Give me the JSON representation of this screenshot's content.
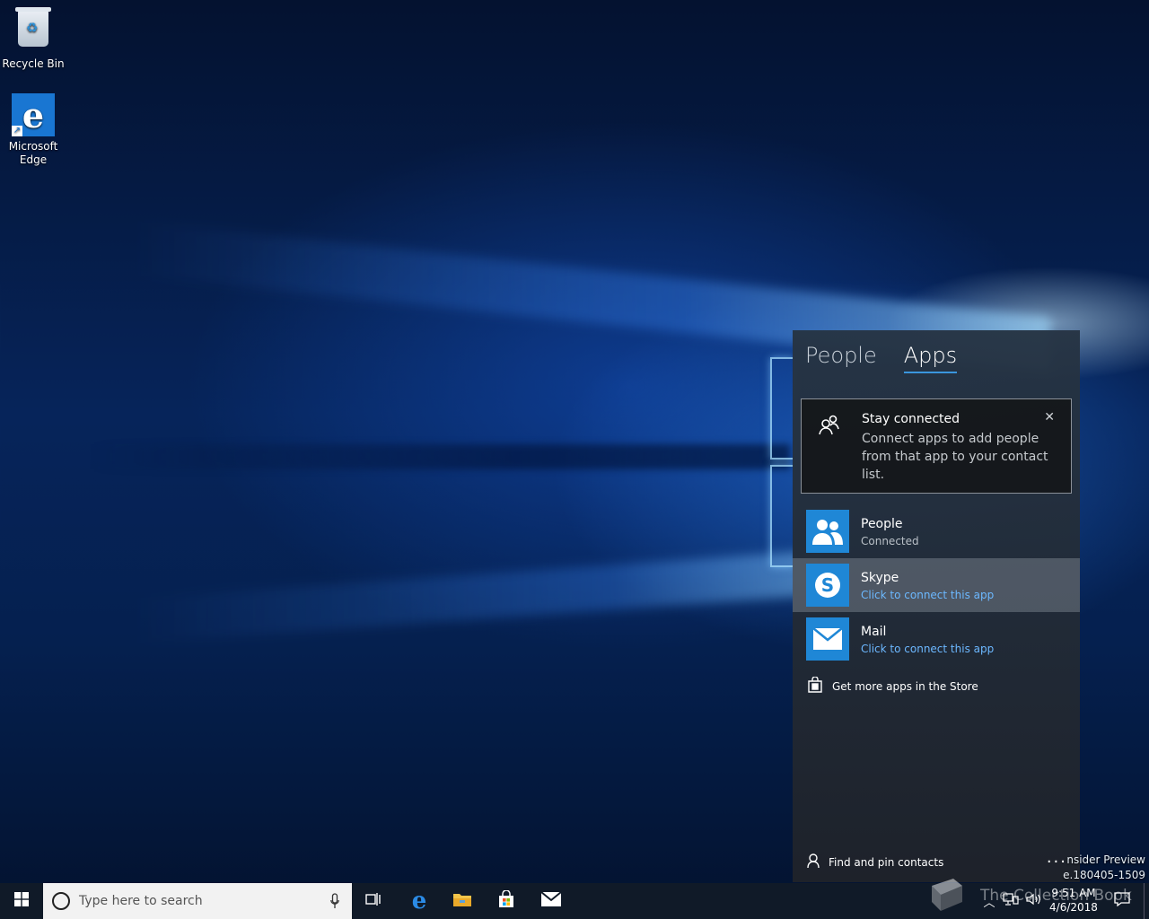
{
  "desktop": {
    "icons": [
      {
        "label": "Recycle Bin"
      },
      {
        "label": "Microsoft Edge"
      }
    ],
    "build_lines": [
      "nsider Preview",
      "e.180405-1509"
    ],
    "watermark": "The Collection Book"
  },
  "flyout": {
    "tabs": [
      {
        "label": "People",
        "active": false
      },
      {
        "label": "Apps",
        "active": true
      }
    ],
    "banner": {
      "title": "Stay connected",
      "body": "Connect apps to add people from that app to your contact list.",
      "close_icon": "close-icon"
    },
    "apps": [
      {
        "name": "People",
        "status": "Connected",
        "icon": "people-icon"
      },
      {
        "name": "Skype",
        "status": "Click to connect this app",
        "icon": "skype-icon"
      },
      {
        "name": "Mail",
        "status": "Click to connect this app",
        "icon": "mail-icon"
      }
    ],
    "store_link": "Get more apps in the Store",
    "find_contacts": "Find and pin contacts",
    "more": "..."
  },
  "taskbar": {
    "search_placeholder": "Type here to search",
    "pinned": [
      "task-view-icon",
      "edge-icon",
      "file-explorer-icon",
      "store-icon",
      "mail-icon"
    ],
    "clock": {
      "time": "9:51 AM",
      "date": "4/6/2018"
    }
  },
  "colors": {
    "accent": "#1f87d6",
    "link": "#6cb8ff",
    "taskbar": "#101a28"
  }
}
